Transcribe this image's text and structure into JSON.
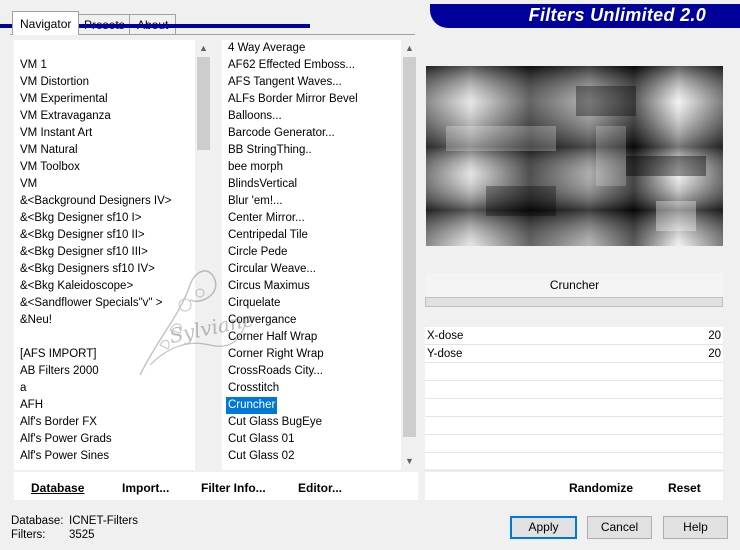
{
  "tabs": [
    "Navigator",
    "Presets",
    "About"
  ],
  "banner_title": "Filters Unlimited 2.0",
  "categories": [
    "VM 1",
    "VM Distortion",
    "VM Experimental",
    "VM Extravaganza",
    "VM Instant Art",
    "VM Natural",
    "VM Toolbox",
    "VM",
    "&<Background Designers IV>",
    "&<Bkg Designer sf10 I>",
    "&<Bkg Designer sf10 II>",
    "&<Bkg Designer sf10 III>",
    "&<Bkg Designers sf10 IV>",
    "&<Bkg Kaleidoscope>",
    "&<Sandflower Specials\"v\" >",
    "&Neu!",
    "",
    "[AFS IMPORT]",
    "AB Filters 2000",
    "a",
    "AFH",
    "Alf's Border FX",
    "Alf's Power Grads",
    "Alf's Power Sines"
  ],
  "filters": [
    "4 Way Average",
    "AF62 Effected Emboss...",
    "AFS Tangent Waves...",
    "ALFs Border Mirror Bevel",
    "Balloons...",
    "Barcode Generator...",
    "BB StringThing..",
    "bee morph",
    "BlindsVertical",
    "Blur 'em!...",
    "Center Mirror...",
    "Centripedal Tile",
    "Circle Pede",
    "Circular Weave...",
    "Circus Maximus",
    "Cirquelate",
    "Convergance",
    "Corner Half Wrap",
    "Corner Right Wrap",
    "CrossRoads City...",
    "Crosstitch",
    "Cruncher",
    "Cut Glass  BugEye",
    "Cut Glass 01",
    "Cut Glass 02"
  ],
  "selected_filter": "Cruncher",
  "filter_title": "Cruncher",
  "params": [
    {
      "label": "X-dose",
      "value": "20"
    },
    {
      "label": "Y-dose",
      "value": "20"
    }
  ],
  "left_buttons": [
    "Database",
    "Import...",
    "Filter Info...",
    "Editor..."
  ],
  "right_buttons": [
    "Randomize",
    "Reset"
  ],
  "status": {
    "database_label": "Database:",
    "database_value": "ICNET-Filters",
    "filters_label": "Filters:",
    "filters_value": "3525"
  },
  "dialog_buttons": [
    "Apply",
    "Cancel",
    "Help"
  ],
  "watermark_text": "Sylviane"
}
